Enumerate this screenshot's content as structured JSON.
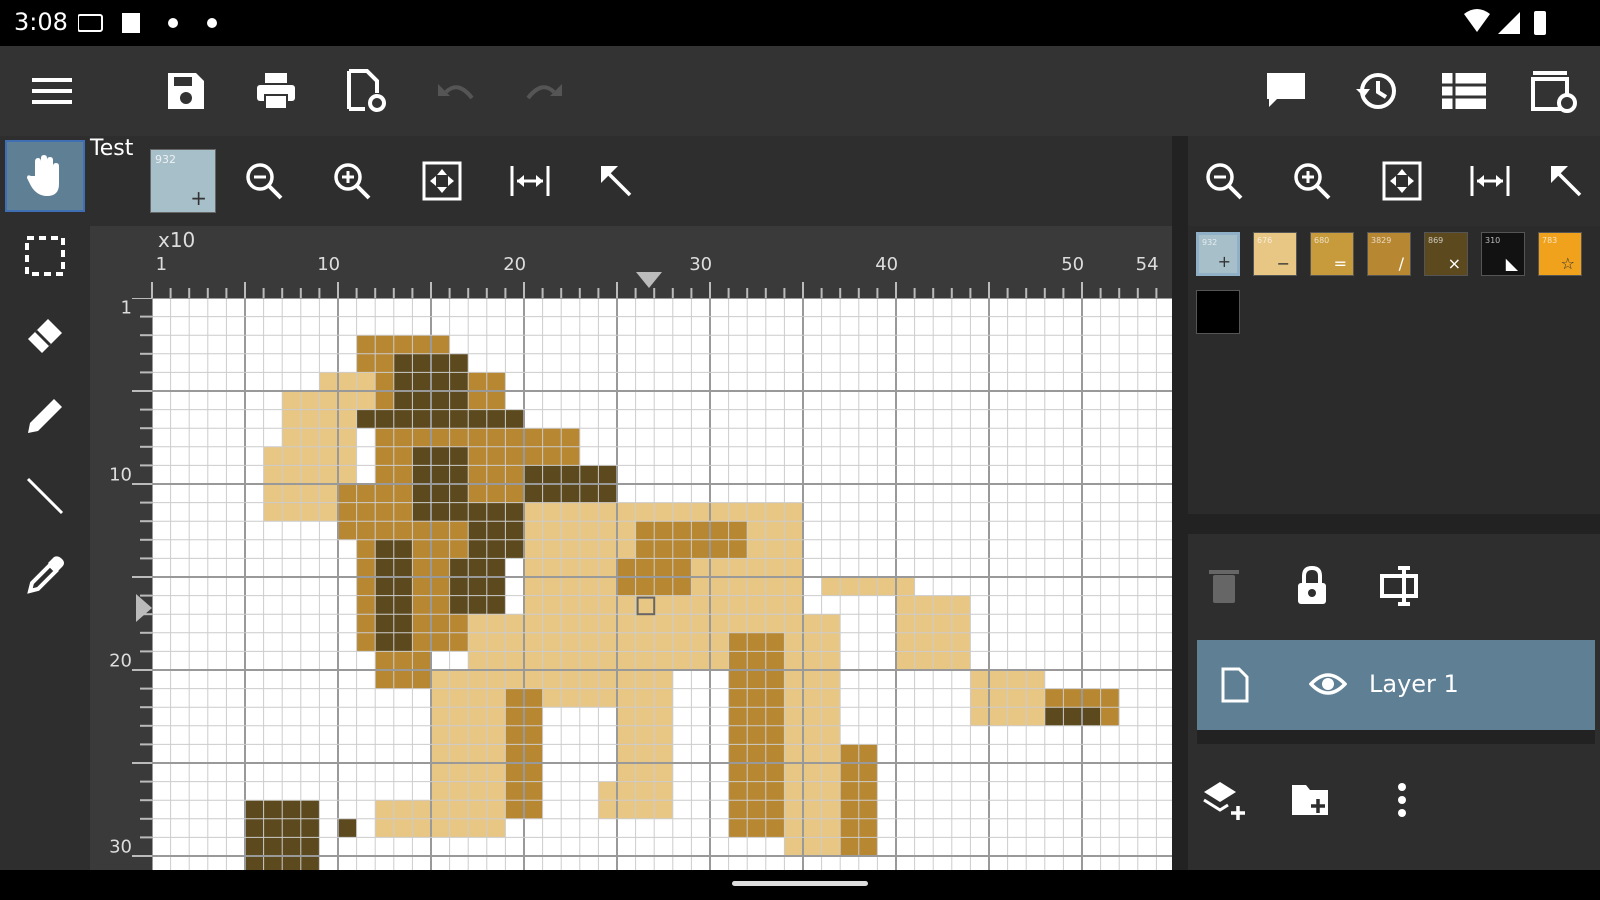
{
  "status": {
    "time": "3:08"
  },
  "toolbar": {
    "icons": [
      "menu-icon",
      "save-icon",
      "print-icon",
      "document-settings-icon",
      "undo-icon",
      "redo-icon",
      "comment-icon",
      "history-icon",
      "list-icon",
      "settings-board-icon"
    ]
  },
  "canvas": {
    "project_name": "Test",
    "palette_preview": {
      "code": "932",
      "symbol": "+"
    },
    "zoom_factor": "x10",
    "col_ticks": [
      "1",
      "10",
      "20",
      "30",
      "40",
      "50",
      "54"
    ],
    "row_ticks": [
      "1",
      "10",
      "20",
      "30"
    ]
  },
  "palette": {
    "swatches": [
      {
        "color": "#a7bfc9",
        "symbol": "+",
        "code": "932"
      },
      {
        "color": "#e8c684",
        "symbol": "−",
        "code": "676"
      },
      {
        "color": "#c79b3c",
        "symbol": "=",
        "code": "680"
      },
      {
        "color": "#b78732",
        "symbol": "/",
        "code": "3829"
      },
      {
        "color": "#5c4a1e",
        "symbol": "×",
        "code": "869"
      },
      {
        "color": "#121212",
        "symbol": "◣",
        "code": "310"
      },
      {
        "color": "#f0a21d",
        "symbol": "☆",
        "code": "783"
      },
      {
        "color": "#000000",
        "symbol": "",
        "code": ""
      }
    ]
  },
  "layers": {
    "items": [
      {
        "label": "Layer 1"
      }
    ]
  },
  "colors": {
    "layer_selected": "#5e7f94",
    "light": "#e8c684",
    "mid": "#b78732",
    "dark": "#5c4a1e"
  }
}
